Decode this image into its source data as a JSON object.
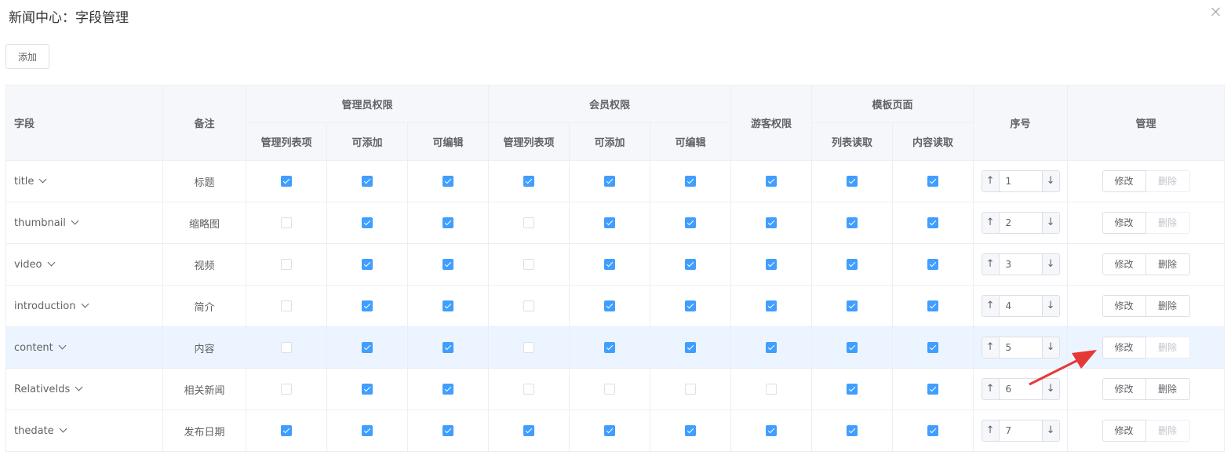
{
  "dialog": {
    "title": "新闻中心：字段管理"
  },
  "toolbar": {
    "add_label": "添加"
  },
  "headers": {
    "field": "字段",
    "remark": "备注",
    "admin_group": "管理员权限",
    "member_group": "会员权限",
    "guest": "游客权限",
    "template_group": "模板页面",
    "order": "序号",
    "manage": "管理",
    "admin_list": "管理列表项",
    "admin_add": "可添加",
    "admin_edit": "可编辑",
    "member_list": "管理列表项",
    "member_add": "可添加",
    "member_edit": "可编辑",
    "tpl_list": "列表读取",
    "tpl_content": "内容读取"
  },
  "arrows": {
    "up": "↑",
    "down": "↓"
  },
  "rows": [
    {
      "field": "title",
      "remark": "标题",
      "checks": [
        true,
        true,
        true,
        true,
        true,
        true,
        true,
        true,
        true
      ],
      "order": "1",
      "edit": "修改",
      "del": "删除",
      "del_disabled": true
    },
    {
      "field": "thumbnail",
      "remark": "缩略图",
      "checks": [
        false,
        true,
        true,
        false,
        true,
        true,
        true,
        true,
        true
      ],
      "order": "2",
      "edit": "修改",
      "del": "删除",
      "del_disabled": true
    },
    {
      "field": "video",
      "remark": "视频",
      "checks": [
        false,
        true,
        true,
        false,
        true,
        true,
        true,
        true,
        true
      ],
      "order": "3",
      "edit": "修改",
      "del": "删除",
      "del_disabled": false
    },
    {
      "field": "introduction",
      "remark": "简介",
      "checks": [
        false,
        true,
        true,
        false,
        true,
        true,
        true,
        true,
        true
      ],
      "order": "4",
      "edit": "修改",
      "del": "删除",
      "del_disabled": false
    },
    {
      "field": "content",
      "remark": "内容",
      "checks": [
        false,
        true,
        true,
        false,
        true,
        true,
        true,
        true,
        true
      ],
      "order": "5",
      "edit": "修改",
      "del": "删除",
      "del_disabled": true
    },
    {
      "field": "RelativeIds",
      "remark": "相关新闻",
      "checks": [
        false,
        true,
        true,
        false,
        false,
        false,
        false,
        true,
        true
      ],
      "order": "6",
      "edit": "修改",
      "del": "删除",
      "del_disabled": false
    },
    {
      "field": "thedate",
      "remark": "发布日期",
      "checks": [
        true,
        true,
        true,
        true,
        true,
        true,
        true,
        true,
        true
      ],
      "order": "7",
      "edit": "修改",
      "del": "删除",
      "del_disabled": true
    }
  ],
  "colors": {
    "accent": "#409eff",
    "header_bg": "#f5f7fa",
    "hover_row": "#ecf5ff",
    "annotation_arrow": "#e53935"
  }
}
